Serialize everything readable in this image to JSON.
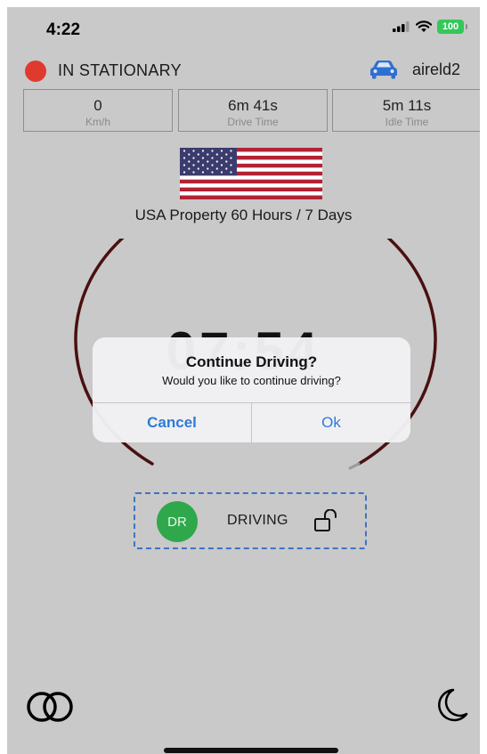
{
  "status_bar": {
    "time": "4:22",
    "battery": "100"
  },
  "vehicle_status": {
    "state": "IN STATIONARY",
    "vehicle_name": "aireld2"
  },
  "stats": [
    {
      "value": "0",
      "label": "Km/h"
    },
    {
      "value": "6m 41s",
      "label": "Drive Time"
    },
    {
      "value": "5m 11s",
      "label": "Idle Time"
    }
  ],
  "rule": {
    "text": "USA Property 60 Hours / 7 Days"
  },
  "gauge": {
    "time": "07:54"
  },
  "alert": {
    "title": "Continue Driving?",
    "message": "Would you like to continue driving?",
    "cancel_label": "Cancel",
    "ok_label": "Ok"
  },
  "duty": {
    "initials": "DR",
    "label": "DRIVING"
  },
  "colors": {
    "background": "#c9c9c9",
    "status_red": "#e03a2f",
    "driving_green": "#2fa84b",
    "accent_blue": "#2f7ad9",
    "gauge_ring": "#4a1010"
  }
}
